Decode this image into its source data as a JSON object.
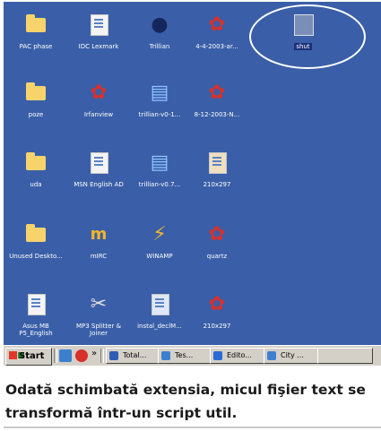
{
  "desktop": {
    "background": "#3a5fa8",
    "icons": [
      {
        "label": "PAC phase",
        "icon": "folder-icon",
        "color": "#f6d46b"
      },
      {
        "label": "IDC Lexmark",
        "icon": "word-doc-icon",
        "color": "#f4f4f4"
      },
      {
        "label": "Trillian",
        "icon": "trillian-icon",
        "color": "#2a3f7a"
      },
      {
        "label": "4-4-2003-ar...",
        "icon": "flower-icon",
        "color": "#d8312a"
      },
      {
        "label": "shut",
        "icon": "script-file-icon",
        "color": "#7b8fb6",
        "selected": true
      },
      {
        "label": "poze",
        "icon": "folder-icon",
        "color": "#f6d46b"
      },
      {
        "label": "Irfanview",
        "icon": "flower-icon",
        "color": "#d8312a"
      },
      {
        "label": "trillian-v0-1...",
        "icon": "installer-icon",
        "color": "#3d7fcf"
      },
      {
        "label": "8-12-2003-N...",
        "icon": "flower-icon",
        "color": "#d8312a"
      },
      {
        "label": "uda",
        "icon": "folder-icon",
        "color": "#f6d46b"
      },
      {
        "label": "MSN English AD",
        "icon": "word-doc-icon",
        "color": "#f4f4f4"
      },
      {
        "label": "trillian-v0.7...",
        "icon": "installer-icon",
        "color": "#3d7fcf"
      },
      {
        "label": "210x297",
        "icon": "image-file-icon",
        "color": "#e5b36b"
      },
      {
        "label": "Unused Deskto...",
        "icon": "folder-icon",
        "color": "#f6d46b"
      },
      {
        "label": "mIRC",
        "icon": "mirc-icon",
        "color": "#8a3f8a"
      },
      {
        "label": "WINAMP",
        "icon": "winamp-icon",
        "color": "#f2b62a"
      },
      {
        "label": "quartz",
        "icon": "flower-icon",
        "color": "#d8312a"
      },
      {
        "label": "Asus MB P5_English",
        "icon": "word-doc-icon",
        "color": "#f4f4f4"
      },
      {
        "label": "MP3 Splitter & Joiner",
        "icon": "scissors-icon",
        "color": "#9a9a9a"
      },
      {
        "label": "instal_declM...",
        "icon": "setup-icon",
        "color": "#3d7fcf"
      },
      {
        "label": "210x297",
        "icon": "flower-icon",
        "color": "#d8312a"
      }
    ]
  },
  "taskbar": {
    "start_label": "Start",
    "quick_launch": [
      "firefox-icon",
      "ie-icon"
    ],
    "overflow_label": "»",
    "buttons": [
      {
        "label": "Total...",
        "icon": "folder-icon",
        "color": "#2f5db3"
      },
      {
        "label": "Tes...",
        "icon": "ie-icon",
        "color": "#3d7fcf"
      },
      {
        "label": "Edito...",
        "icon": "editor-icon",
        "color": "#2b6bd1"
      },
      {
        "label": "City ...",
        "icon": "ie-icon",
        "color": "#3d7fcf"
      }
    ]
  },
  "caption": {
    "text": "Odată schimbată extensia, micul fişier text se transformă într-un script util."
  }
}
